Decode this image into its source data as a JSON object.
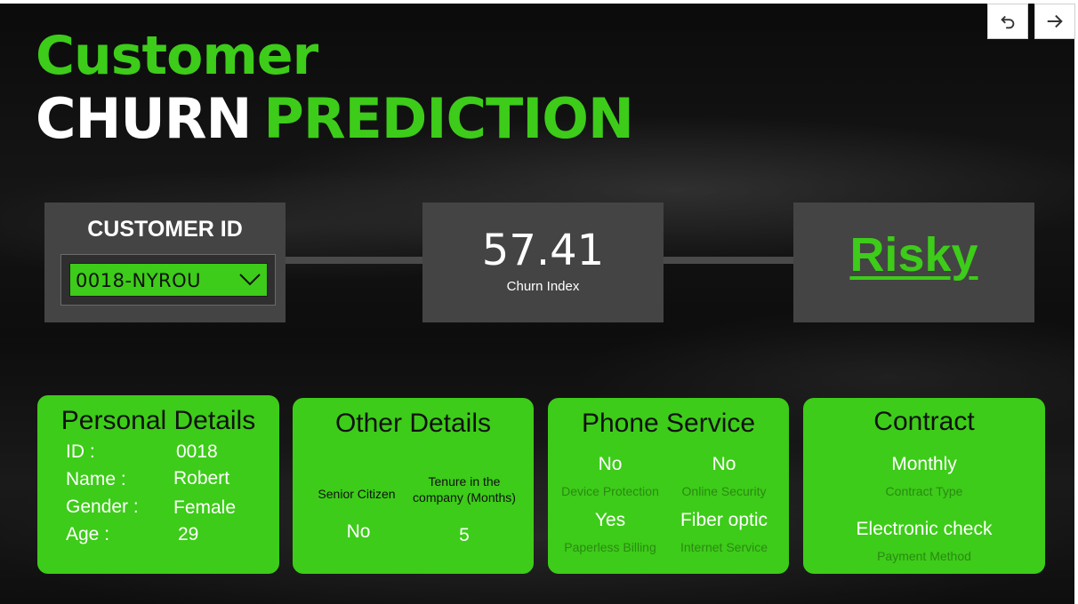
{
  "nav": {
    "back_icon": "undo-arrow-icon",
    "forward_icon": "right-arrow-icon"
  },
  "title": {
    "line1": "Customer",
    "line2_white": "CHURN",
    "line2_green": "PREDICTION"
  },
  "customer": {
    "label": "CUSTOMER ID",
    "selected_id": "0018-NYROU"
  },
  "churn": {
    "value": "57.41",
    "label": "Churn Index"
  },
  "risk": {
    "label": "Risky"
  },
  "personal": {
    "title": "Personal Details",
    "rows": [
      {
        "label": "ID :",
        "value": "0018"
      },
      {
        "label": "Name :",
        "value": "Robert"
      },
      {
        "label": "Gender :",
        "value": "Female"
      },
      {
        "label": "Age :",
        "value": "29"
      }
    ]
  },
  "other": {
    "title": "Other Details",
    "senior_label": "Senior Citizen",
    "tenure_label_1": "Tenure in the",
    "tenure_label_2": "company (Months)",
    "senior_value": "No",
    "tenure_value": "5"
  },
  "phone": {
    "title": "Phone Service",
    "items": [
      {
        "value": "No",
        "label": "Device Protection"
      },
      {
        "value": "No",
        "label": "Online Security"
      },
      {
        "value": "Yes",
        "label": "Paperless Billing"
      },
      {
        "value": "Fiber optic",
        "label": "Internet Service"
      }
    ]
  },
  "contract": {
    "title": "Contract",
    "type_value": "Monthly",
    "type_label": "Contract Type",
    "payment_value": "Electronic check",
    "payment_label": "Payment Method"
  },
  "colors": {
    "accent_green": "#3dcc19",
    "tile_gray": "#444444",
    "background": "#0d0d0d"
  }
}
